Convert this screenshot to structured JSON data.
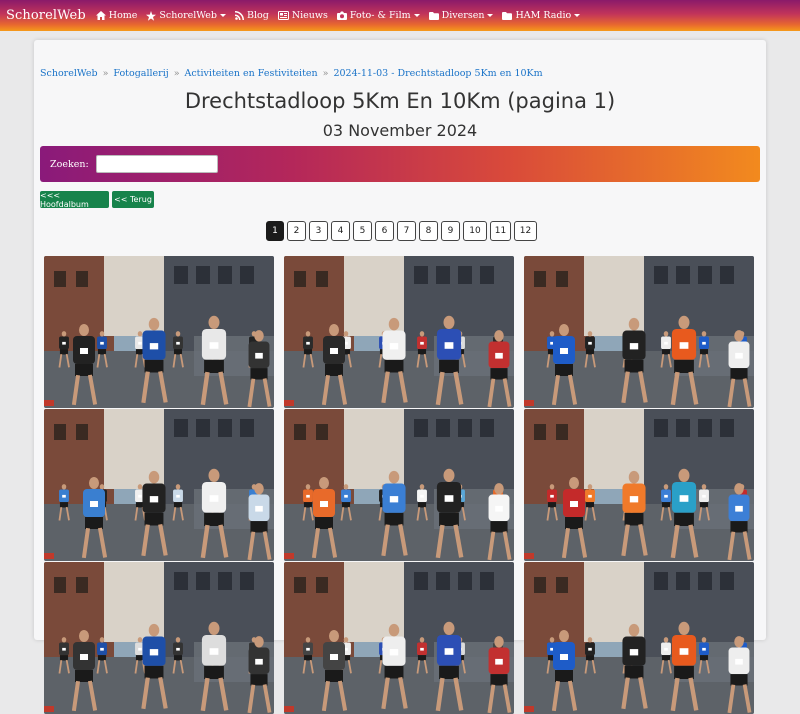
{
  "navbar": {
    "brand": "SchorelWeb",
    "items": [
      {
        "label": "Home",
        "icon": "home-icon",
        "dropdown": false
      },
      {
        "label": "SchorelWeb",
        "icon": "star-icon",
        "dropdown": true
      },
      {
        "label": "Blog",
        "icon": "rss-icon",
        "dropdown": false
      },
      {
        "label": "Nieuws",
        "icon": "newspaper-icon",
        "dropdown": false
      },
      {
        "label": "Foto- & Film",
        "icon": "camera-icon",
        "dropdown": true
      },
      {
        "label": "Diversen",
        "icon": "folder-icon",
        "dropdown": true
      },
      {
        "label": "HAM Radio",
        "icon": "folder-icon",
        "dropdown": true
      }
    ]
  },
  "breadcrumb": [
    "SchorelWeb",
    "Fotogallerij",
    "Activiteiten en Festiviteiten",
    "2024-11-03 - Drechtstadloop 5Km en 10Km"
  ],
  "title": "Drechtstadloop 5Km En 10Km (pagina 1)",
  "subtitle": "03 November 2024",
  "search": {
    "label": "Zoeken:",
    "value": ""
  },
  "buttons": {
    "main_album": "<<< Hoofdalbum",
    "back": "<< Terug"
  },
  "pagination": {
    "pages": [
      "1",
      "2",
      "3",
      "4",
      "5",
      "6",
      "7",
      "8",
      "9",
      "10",
      "11",
      "12"
    ],
    "active": "1"
  },
  "photos": [
    {
      "id": "photo-1"
    },
    {
      "id": "photo-2"
    },
    {
      "id": "photo-3"
    },
    {
      "id": "photo-4"
    },
    {
      "id": "photo-5"
    },
    {
      "id": "photo-6"
    },
    {
      "id": "photo-7"
    },
    {
      "id": "photo-8"
    },
    {
      "id": "photo-9"
    }
  ],
  "colors": {
    "accent_start": "#8a1a6a",
    "accent_end": "#f59a1a",
    "button_green": "#17834b",
    "link_blue": "#1a73c8"
  }
}
